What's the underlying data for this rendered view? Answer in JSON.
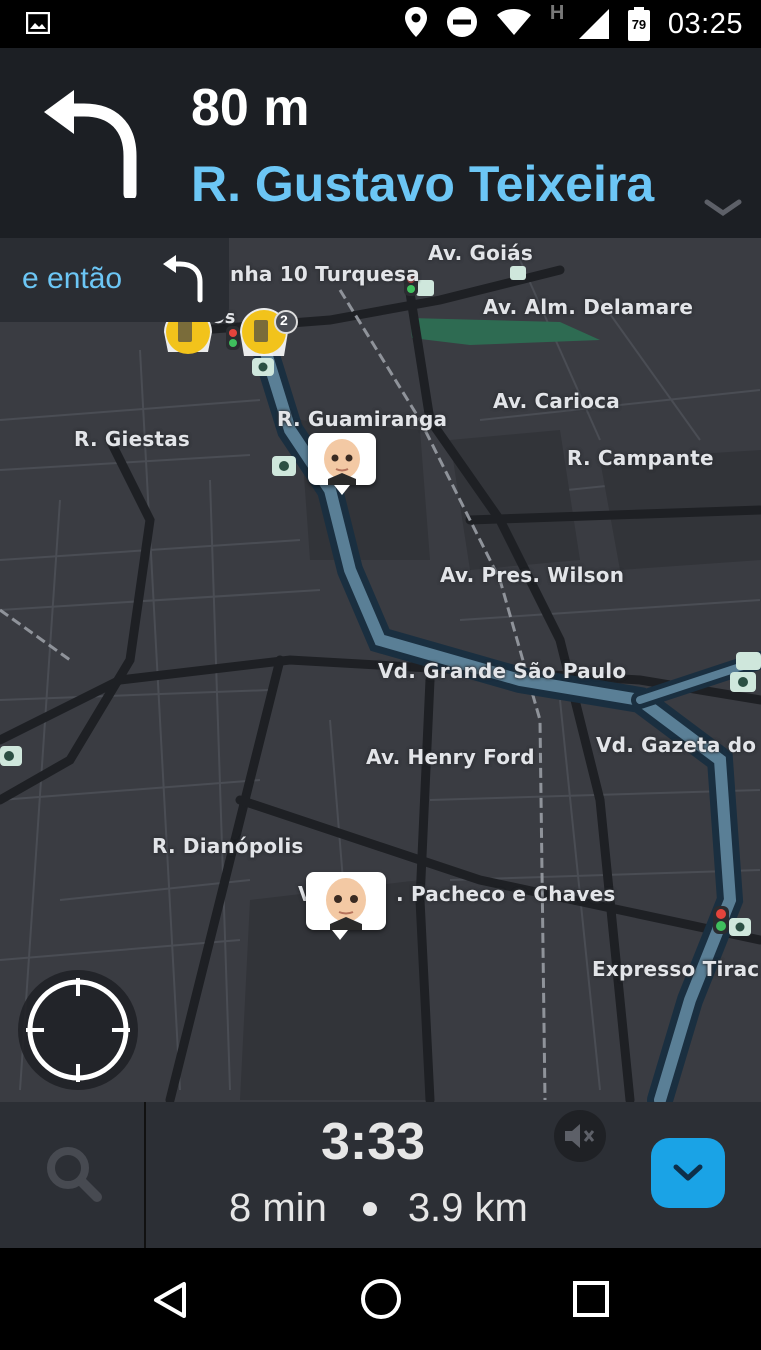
{
  "status_bar": {
    "time": "03:25",
    "battery_level": "79",
    "network": "H"
  },
  "navigation": {
    "distance": "80 m",
    "street": "R. Gustavo Teixeira",
    "then_label": "e então"
  },
  "map": {
    "street_labels": [
      "Av. Goiás",
      "nha 10 Turquesa",
      "Av. Alm. Delamare",
      "R. Guamiranga",
      "Av. Carioca",
      "R. Giestas",
      "R. Campante",
      "Av. Pres. Wilson",
      "Vd. Grande São Paulo",
      "Vd. Gazeta do I",
      "Av. Henry Ford",
      "R. Dianópolis",
      ". Pacheco e Chaves",
      "Expresso Tirac",
      "os",
      "V"
    ],
    "alert_count": "2"
  },
  "trip": {
    "eta": "3:33",
    "duration": "8 min",
    "distance": "3.9 km"
  },
  "colors": {
    "accent_blue": "#6cc6f5",
    "button_blue": "#1aa3e6",
    "route_blue": "#5a7f96",
    "alert_yellow": "#f2c31b"
  }
}
